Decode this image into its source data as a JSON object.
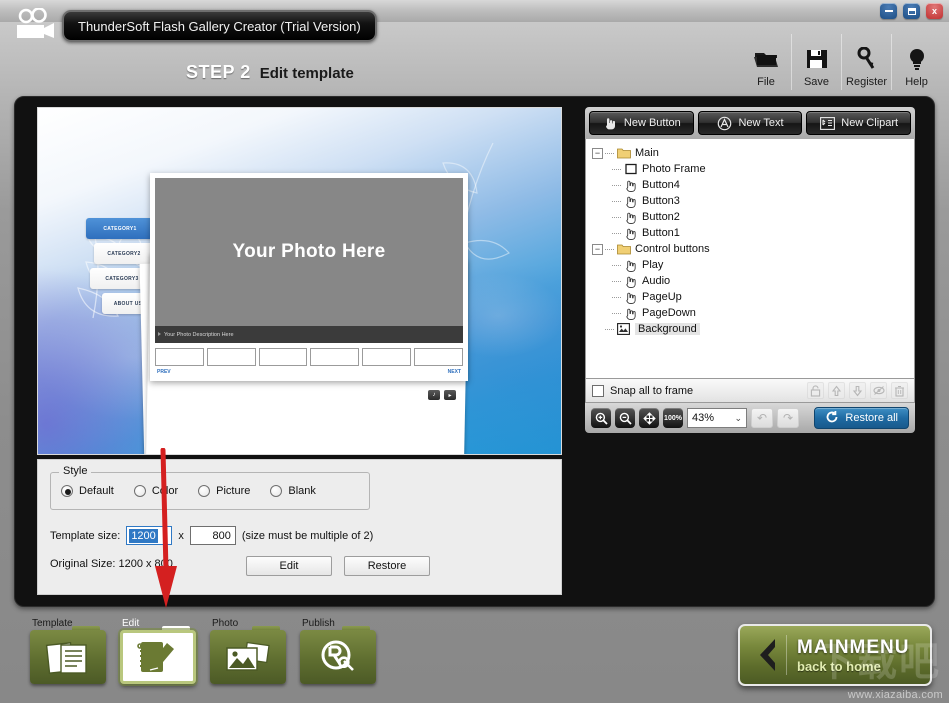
{
  "window": {
    "product_title": "ThunderSoft Flash Gallery Creator (Trial Version)",
    "minimize": "−",
    "maximize": "▢",
    "close": "x"
  },
  "header": {
    "step_number": "STEP 2",
    "step_label": "Edit template",
    "tools": [
      {
        "label": "File",
        "icon": "folder-icon"
      },
      {
        "label": "Save",
        "icon": "floppy-disk-icon"
      },
      {
        "label": "Register",
        "icon": "key-icon"
      },
      {
        "label": "Help",
        "icon": "lightbulb-icon"
      }
    ]
  },
  "preview": {
    "categories": [
      {
        "label": "CATEGORY1",
        "active": true
      },
      {
        "label": "CATEGORY2",
        "active": false
      },
      {
        "label": "CATEGORY3",
        "active": false
      },
      {
        "label": "ABOUT US",
        "active": false
      }
    ],
    "photo_placeholder": "Your Photo Here",
    "photo_description": "Your Photo Description Here",
    "prev_label": "PREV",
    "next_label": "NEXT",
    "thumbnail_count": 6
  },
  "objects_panel": {
    "new_button": "New Button",
    "new_text": "New Text",
    "new_clipart": "New Clipart",
    "tree": [
      {
        "label": "Main",
        "icon": "folder-icon",
        "level": 0,
        "expander": "−",
        "selected": false
      },
      {
        "label": "Photo Frame",
        "icon": "frame-icon",
        "level": 1,
        "selected": false
      },
      {
        "label": "Button4",
        "icon": "hand-cursor-icon",
        "level": 1,
        "selected": false
      },
      {
        "label": "Button3",
        "icon": "hand-cursor-icon",
        "level": 1,
        "selected": false
      },
      {
        "label": "Button2",
        "icon": "hand-cursor-icon",
        "level": 1,
        "selected": false
      },
      {
        "label": "Button1",
        "icon": "hand-cursor-icon",
        "level": 1,
        "selected": false
      },
      {
        "label": "Control buttons",
        "icon": "folder-icon",
        "level": 0,
        "expander": "−",
        "selected": false
      },
      {
        "label": "Play",
        "icon": "hand-cursor-icon",
        "level": 1,
        "selected": false
      },
      {
        "label": "Audio",
        "icon": "hand-cursor-icon",
        "level": 1,
        "selected": false
      },
      {
        "label": "PageUp",
        "icon": "hand-cursor-icon",
        "level": 1,
        "selected": false
      },
      {
        "label": "PageDown",
        "icon": "hand-cursor-icon",
        "level": 1,
        "selected": false
      },
      {
        "label": "Background",
        "icon": "image-icon",
        "level": 0,
        "expander": "",
        "selected": true
      }
    ],
    "snap_label": "Snap all to frame",
    "snap_checked": false,
    "row_tools": [
      "lock-icon",
      "move-up-icon",
      "move-down-icon",
      "visibility-icon",
      "delete-icon"
    ],
    "zoom_tools": [
      "zoom-in-icon",
      "zoom-out-icon",
      "fit-icon",
      "actual-size-icon"
    ],
    "zoom_value": "43%",
    "restore_all": "Restore all"
  },
  "settings": {
    "style_legend": "Style",
    "style_options": [
      {
        "label": "Default",
        "selected": true
      },
      {
        "label": "Color",
        "selected": false
      },
      {
        "label": "Picture",
        "selected": false
      },
      {
        "label": "Blank",
        "selected": false
      }
    ],
    "template_size_label": "Template size:",
    "width_value": "1200",
    "separator": "x",
    "height_value": "800",
    "size_hint": "(size must be multiple of 2)",
    "original_size": "Original Size: 1200 x 800",
    "edit_button": "Edit",
    "restore_button": "Restore"
  },
  "bottom_nav": [
    {
      "label": "Template",
      "icon": "documents-icon",
      "active": false
    },
    {
      "label": "Edit",
      "icon": "notebook-pencil-icon",
      "active": true
    },
    {
      "label": "Photo",
      "icon": "photos-icon",
      "active": false
    },
    {
      "label": "Publish",
      "icon": "publish-icon",
      "active": false
    }
  ],
  "mainmenu": {
    "title": "MAINMENU",
    "subtitle": "back to home",
    "arrow_icon": "chevron-left-icon"
  },
  "watermark": {
    "url": "www.xiazaiba.com"
  },
  "colors": {
    "accent_blue": "#2f78c4",
    "olive": "#78883c",
    "panel_dark": "#111111"
  }
}
